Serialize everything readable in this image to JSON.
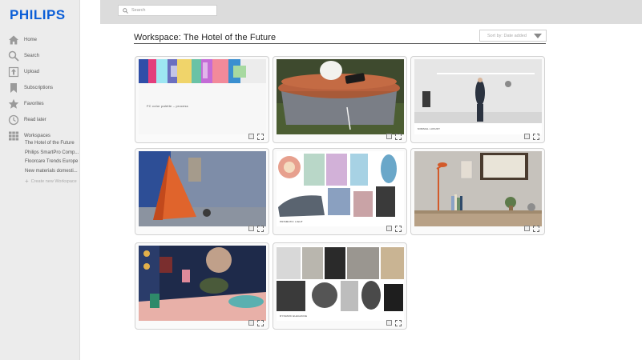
{
  "brand": {
    "logo_text": "PHILIPS",
    "color": "#0b5ed7"
  },
  "search": {
    "placeholder": "Search"
  },
  "sidebar": {
    "items": [
      {
        "label": "Home",
        "icon": "home-icon"
      },
      {
        "label": "Search",
        "icon": "search-icon"
      },
      {
        "label": "Upload",
        "icon": "upload-icon"
      },
      {
        "label": "Subscriptions",
        "icon": "bookmark-icon"
      },
      {
        "label": "Favorites",
        "icon": "star-icon"
      },
      {
        "label": "Read later",
        "icon": "clock-icon"
      },
      {
        "label": "Workspaces",
        "icon": "grid-icon"
      }
    ],
    "workspaces": [
      "The Hotel of the Future",
      "Philips SmartPro Comp...",
      "Floorcare Trends Europe",
      "New materials domesti..."
    ],
    "create_label": "Create new Workspace"
  },
  "main": {
    "title": "Workspace: The Hotel of the Future",
    "sort_label": "Sort by: Date added"
  },
  "cards": [
    {
      "name": "color-palette-board",
      "caption": "FC color palette – process"
    },
    {
      "name": "wireless-charging-table",
      "caption": ""
    },
    {
      "name": "white-room-figure",
      "caption": "MINIMAL LUXURY"
    },
    {
      "name": "orange-triangle-sculpture",
      "caption": ""
    },
    {
      "name": "prismatic-light-collage",
      "caption": "PRISMATIC LIGHT"
    },
    {
      "name": "shelf-interior",
      "caption": ""
    },
    {
      "name": "colorful-lounge-interior",
      "caption": ""
    },
    {
      "name": "dynamic-elegance-collage",
      "caption": "DYNAMIC ELEGANCE"
    }
  ],
  "colors": {
    "accent": "#0b5ed7",
    "sidebar_bg": "#ececec",
    "topbar_bg": "#dcdcdc"
  }
}
